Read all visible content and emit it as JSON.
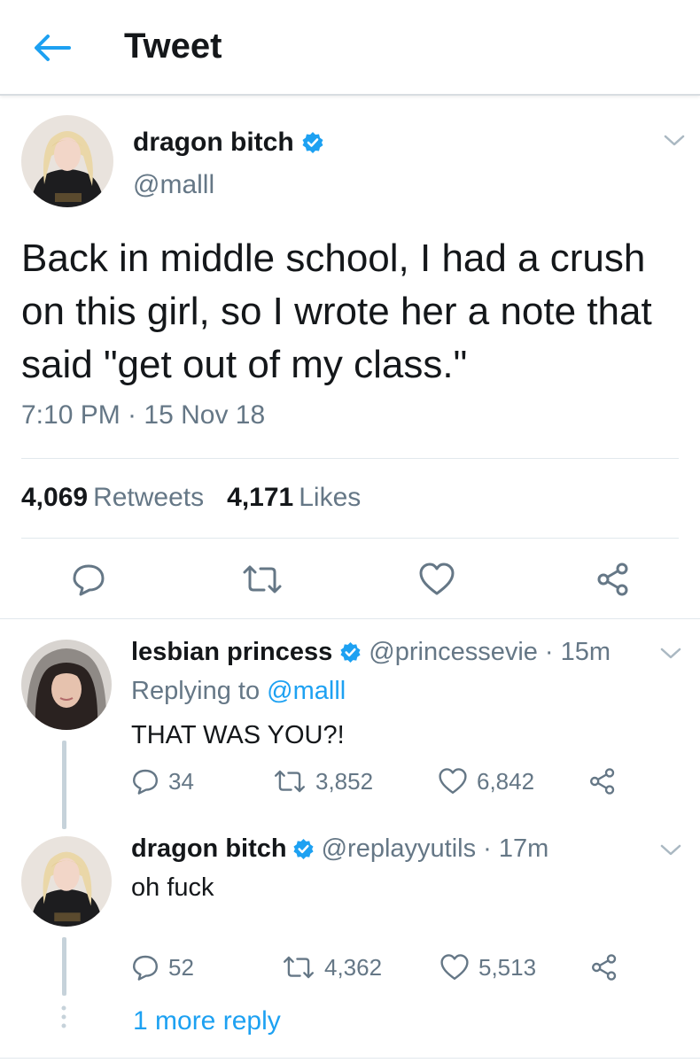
{
  "header": {
    "title": "Tweet",
    "back_icon": "arrow-left-icon"
  },
  "colors": {
    "accent": "#1da1f2",
    "secondary_text": "#657786",
    "primary_text": "#14171a",
    "divider": "#e1e8ed"
  },
  "main_tweet": {
    "display_name": "dragon bitch",
    "handle": "@malll",
    "verified": true,
    "text": "Back in middle school, I had a crush on this girl, so I wrote her a note that said \"get out of my class.\"",
    "timestamp": "7:10 PM · 15 Nov 18",
    "retweets_count": "4,069",
    "retweets_label": "Retweets",
    "likes_count": "4,171",
    "likes_label": "Likes",
    "actions": [
      "reply-icon",
      "retweet-icon",
      "heart-icon",
      "share-icon"
    ]
  },
  "replies": [
    {
      "display_name": "lesbian princess",
      "handle": "@princessevie",
      "time": "· 15m",
      "verified": true,
      "replying_prefix": "Replying to",
      "replying_to": "@malll",
      "text": "THAT WAS YOU?!",
      "reply_count": "34",
      "retweet_count": "3,852",
      "like_count": "6,842"
    },
    {
      "display_name": "dragon bitch",
      "handle": "@replayyutils",
      "time": "· 17m",
      "verified": true,
      "text": "oh fuck",
      "reply_count": "52",
      "retweet_count": "4,362",
      "like_count": "5,513"
    }
  ],
  "more_replies_label": "1 more reply"
}
